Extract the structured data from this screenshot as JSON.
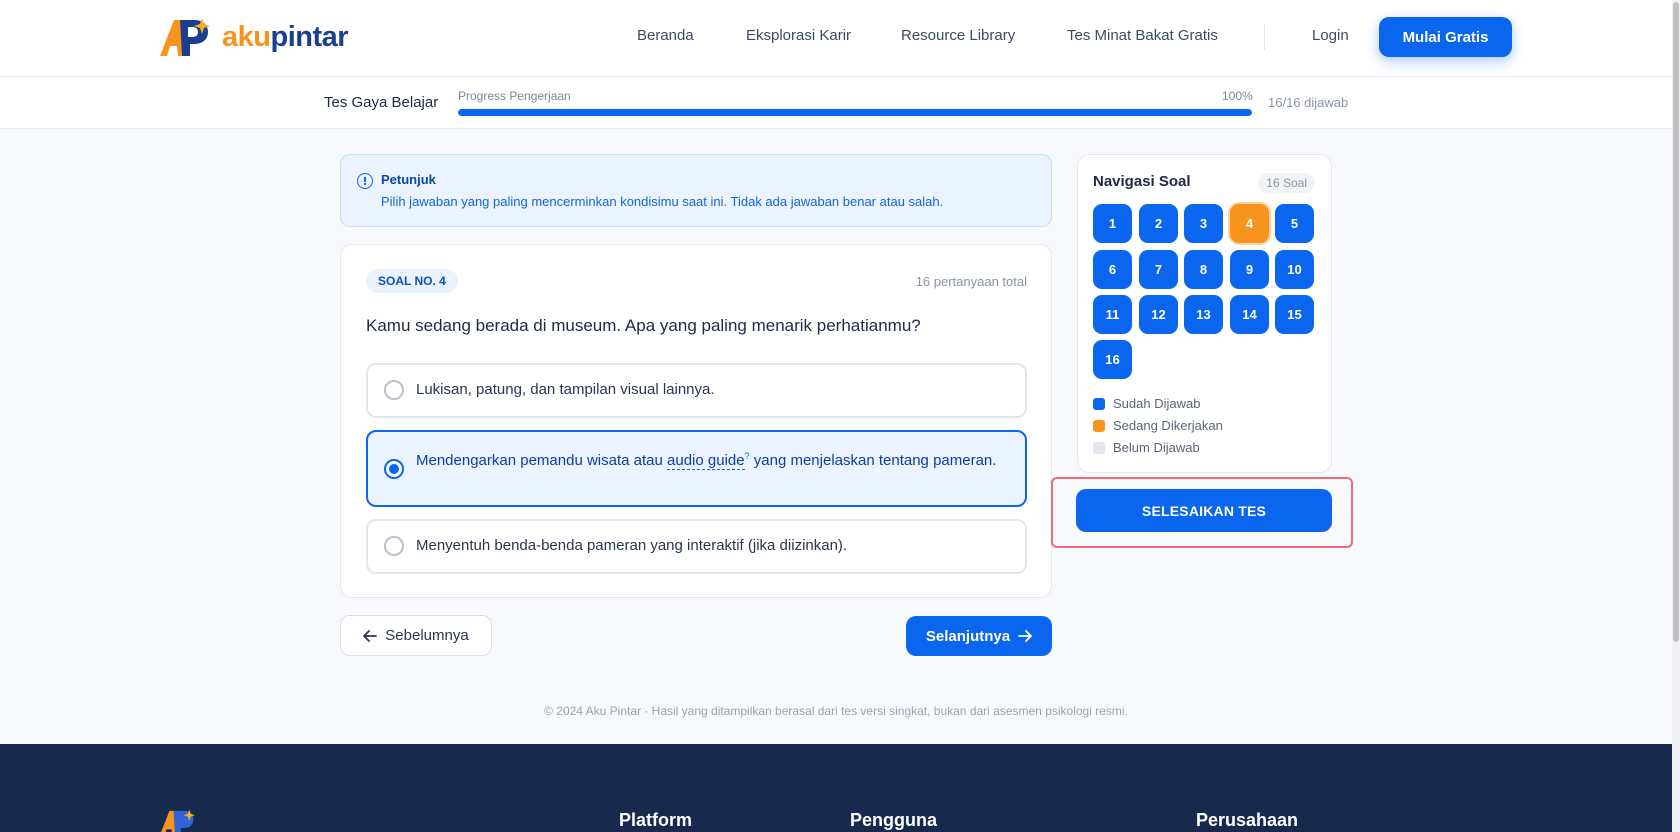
{
  "brand": {
    "part1": "aku",
    "part2": "pintar"
  },
  "nav": {
    "items": [
      "Beranda",
      "Eksplorasi Karir",
      "Resource Library",
      "Tes Minat Bakat Gratis"
    ],
    "login": "Login",
    "cta": "Mulai Gratis"
  },
  "progress": {
    "title": "Tes Gaya Belajar",
    "label": "Progress Pengerjaan",
    "percent_text": "100%",
    "fraction": 1.0,
    "count_text": "16/16 dijawab"
  },
  "info": {
    "title": "Petunjuk",
    "text": "Pilih jawaban yang paling mencerminkan kondisimu saat ini. Tidak ada jawaban benar atau salah."
  },
  "question": {
    "badge": "SOAL NO. 4",
    "total": "16 pertanyaan total",
    "text": "Kamu sedang berada di museum. Apa yang paling menarik perhatianmu?",
    "options": [
      {
        "text": "Lukisan, patung, dan tampilan visual lainnya.",
        "selected": false
      },
      {
        "text_before": "Mendengarkan pemandu wisata atau ",
        "glossary": "audio guide",
        "glossary_mark": "?",
        "text_after": " yang menjelaskan tentang pameran.",
        "selected": true
      },
      {
        "text": "Menyentuh benda-benda pameran yang interaktif (jika diizinkan).",
        "selected": false
      }
    ]
  },
  "buttons": {
    "prev": "Sebelumnya",
    "next": "Selanjutnya",
    "finish": "SELESAIKAN TES",
    "prev_icon": "arrow-left-icon",
    "next_icon": "arrow-right-icon"
  },
  "navigator": {
    "title": "Navigasi Soal",
    "count": "16 Soal",
    "numbers": [
      "1",
      "2",
      "3",
      "4",
      "5",
      "6",
      "7",
      "8",
      "9",
      "10",
      "11",
      "12",
      "13",
      "14",
      "15",
      "16"
    ],
    "current": "4",
    "legend": [
      {
        "label": "Sudah Dijawab",
        "color": "#0a66ef"
      },
      {
        "label": "Sedang Dikerjakan",
        "color": "#f7941d"
      },
      {
        "label": "Belum Dijawab",
        "color": "#e3e6ec"
      }
    ]
  },
  "copyright": "© 2024 Aku Pintar · Hasil yang ditampilkan berasal dari tes versi singkat, bukan dari asesmen psikologi resmi.",
  "footer": {
    "headings": [
      "Platform",
      "Pengguna",
      "Perusahaan"
    ]
  },
  "colors": {
    "primary": "#0a66ef",
    "accent": "#f7941d",
    "footer_bg": "#17294d"
  }
}
